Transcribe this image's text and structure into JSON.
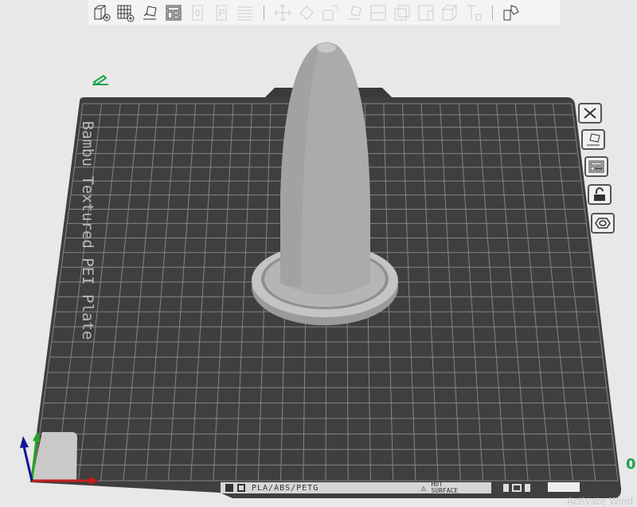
{
  "toolbar": {
    "items": [
      "add-object",
      "add-plate",
      "auto-orient",
      "arrange",
      "plate-0",
      "plate-p",
      "layers",
      "move",
      "rotate",
      "scale",
      "lay-on-face",
      "cut",
      "boolean",
      "paint-support",
      "paint-seam",
      "text",
      "assembly"
    ]
  },
  "plate": {
    "name": "Bambu Textured PEI Plate",
    "filament_label": "PLA/ABS/PETG",
    "warning_line1": "HOT",
    "warning_line2": "SURFACE"
  },
  "side_buttons": [
    "close",
    "auto-orient",
    "arrange",
    "lock",
    "settings"
  ],
  "right_indicator": "0",
  "watermark": "Activate Wind",
  "colors": {
    "plate": "#3f3f3f",
    "grid": "#8a8a8a",
    "model": "#a9a9a9",
    "accent": "#1aa34a"
  }
}
